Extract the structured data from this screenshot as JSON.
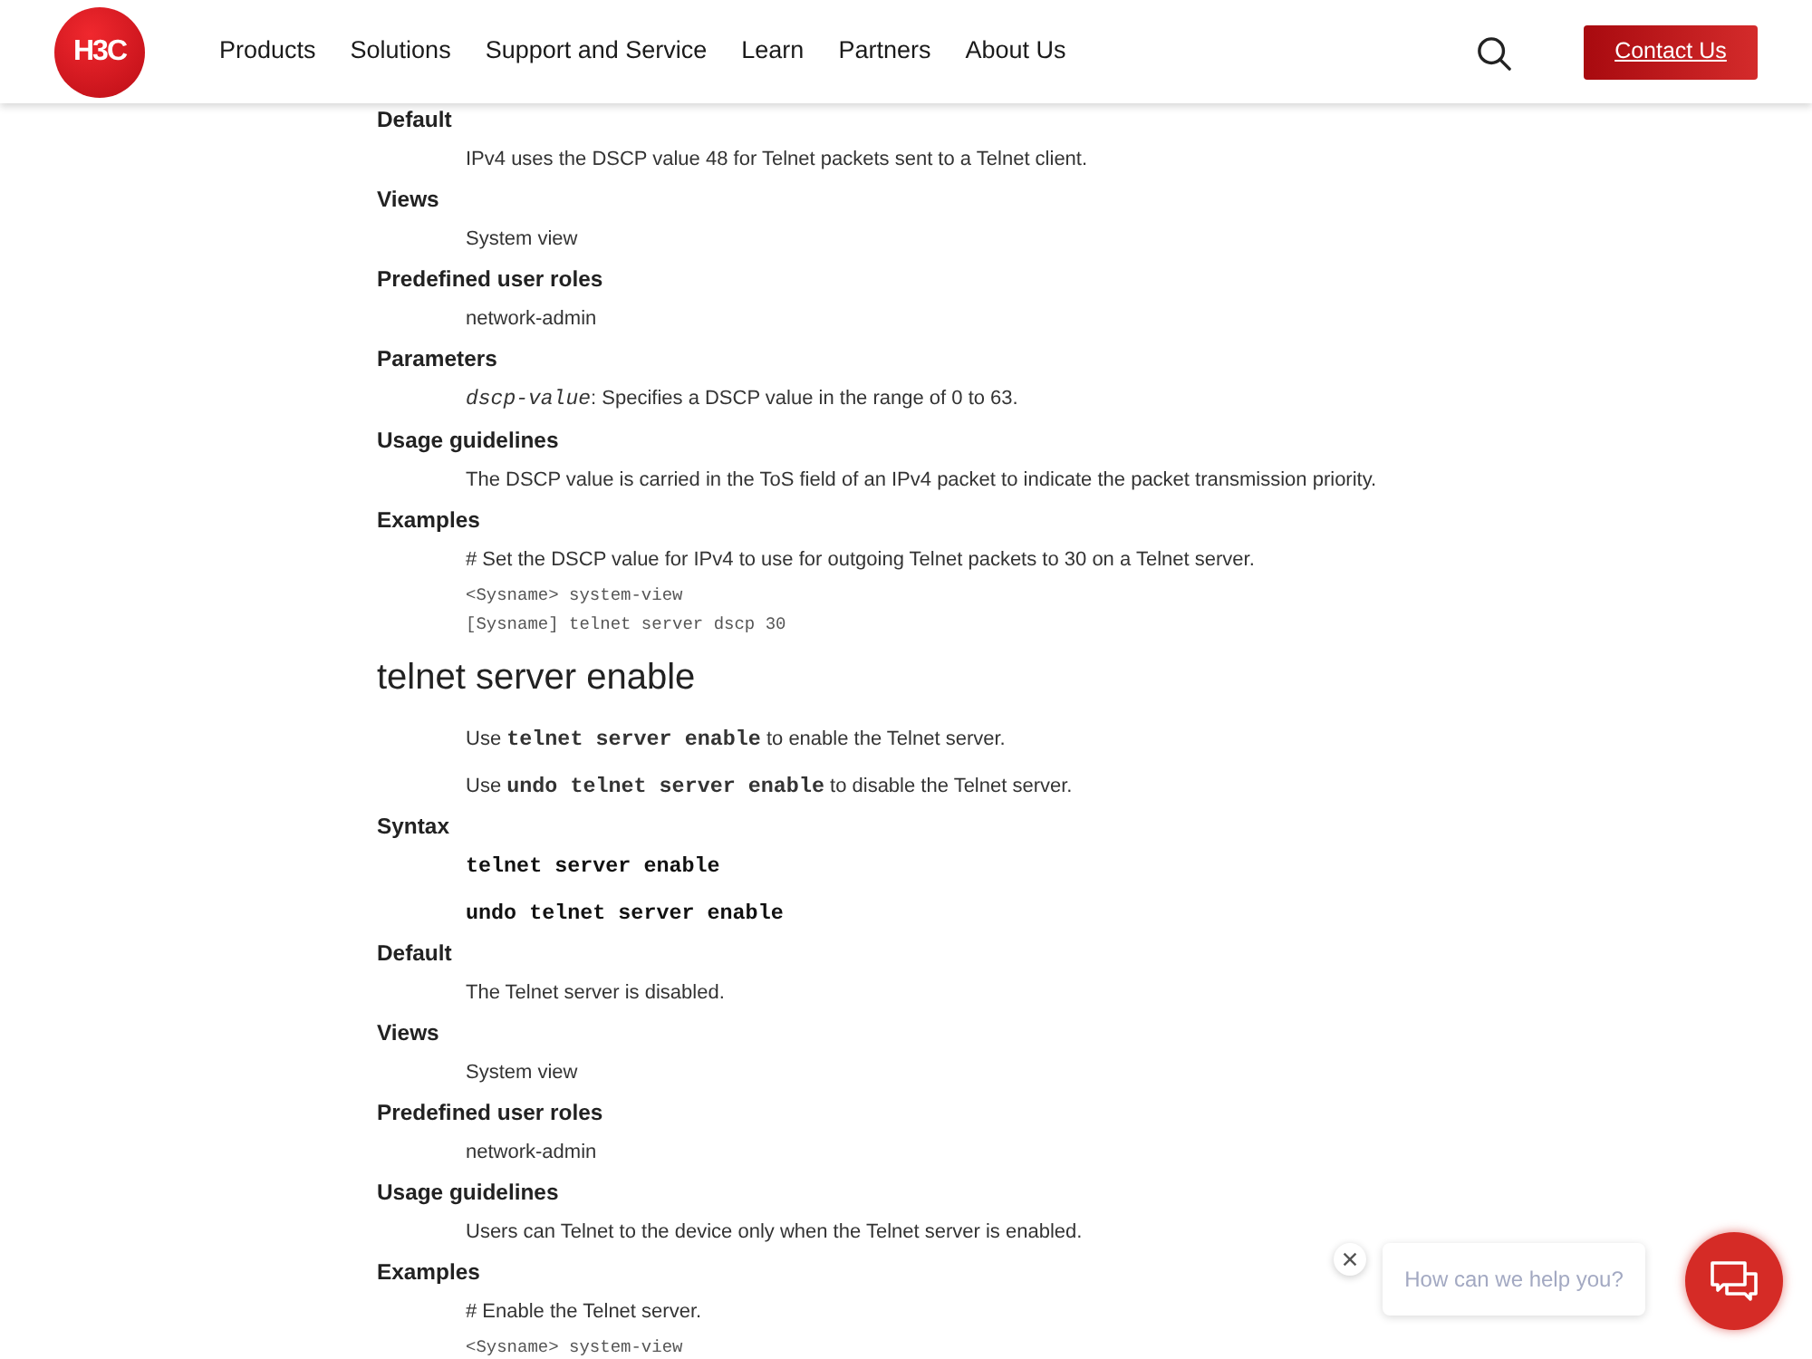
{
  "header": {
    "logo": "H3C",
    "nav": [
      {
        "label": "Products"
      },
      {
        "label": "Solutions"
      },
      {
        "label": "Support and Service"
      },
      {
        "label": "Learn"
      },
      {
        "label": "Partners"
      },
      {
        "label": "About Us"
      }
    ],
    "contact_button": "Contact Us"
  },
  "sections": [
    {
      "fields": [
        {
          "label": "Default",
          "lines": [
            {
              "kind": "text",
              "text": "IPv4 uses the DSCP value 48 for Telnet packets sent to a Telnet client."
            }
          ]
        },
        {
          "label": "Views",
          "lines": [
            {
              "kind": "text",
              "text": "System view"
            }
          ]
        },
        {
          "label": "Predefined user roles",
          "lines": [
            {
              "kind": "text",
              "text": "network-admin"
            }
          ]
        },
        {
          "label": "Parameters",
          "lines": [
            {
              "kind": "text",
              "text": "*dscp-value*: Specifies a DSCP value in the range of 0 to 63."
            }
          ]
        },
        {
          "label": "Usage guidelines",
          "lines": [
            {
              "kind": "text",
              "text": "The DSCP value is carried in the ToS field of an IPv4 packet to indicate the packet transmission priority."
            }
          ]
        },
        {
          "label": "Examples",
          "lines": [
            {
              "kind": "text",
              "text": "# Set the DSCP value for IPv4 to use for outgoing Telnet packets to 30 on a Telnet server."
            },
            {
              "kind": "code",
              "text": "<Sysname> system-view"
            },
            {
              "kind": "code",
              "text": "[Sysname] telnet server dscp 30"
            }
          ]
        }
      ]
    },
    {
      "title": "telnet server enable",
      "intro": [
        "Use **telnet server enable** to enable the Telnet server.",
        "Use **undo telnet server enable** to disable the Telnet server."
      ],
      "fields": [
        {
          "label": "Syntax",
          "lines": [
            {
              "kind": "syntax",
              "text": "telnet server enable"
            },
            {
              "kind": "syntax",
              "text": "undo telnet server enable"
            }
          ]
        },
        {
          "label": "Default",
          "lines": [
            {
              "kind": "text",
              "text": "The Telnet server is disabled."
            }
          ]
        },
        {
          "label": "Views",
          "lines": [
            {
              "kind": "text",
              "text": "System view"
            }
          ]
        },
        {
          "label": "Predefined user roles",
          "lines": [
            {
              "kind": "text",
              "text": "network-admin"
            }
          ]
        },
        {
          "label": "Usage guidelines",
          "lines": [
            {
              "kind": "text",
              "text": "Users can Telnet to the device only when the Telnet server is enabled."
            }
          ]
        },
        {
          "label": "Examples",
          "lines": [
            {
              "kind": "text",
              "text": "# Enable the Telnet server."
            },
            {
              "kind": "code",
              "text": "<Sysname> system-view"
            }
          ]
        }
      ]
    }
  ],
  "chat": {
    "prompt": "How can we help you?"
  }
}
